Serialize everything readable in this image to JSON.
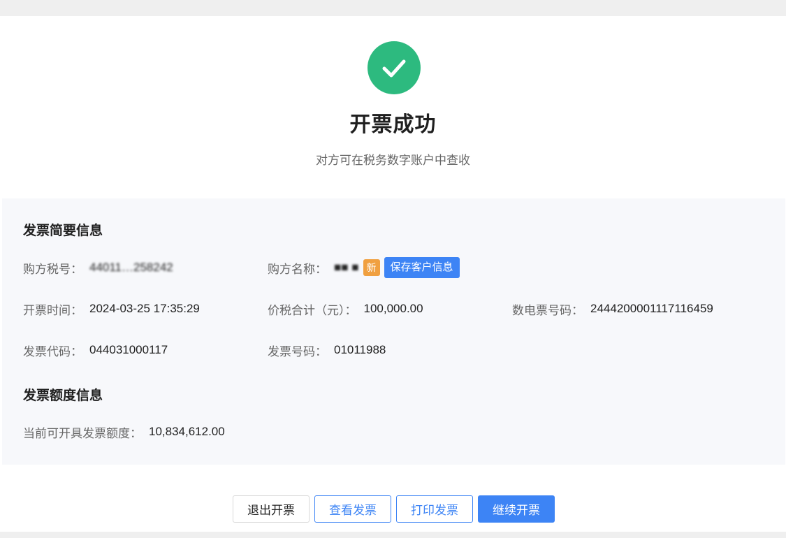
{
  "colors": {
    "success": "#2dba7f",
    "primary": "#3d84f5",
    "tag_new": "#f0a040"
  },
  "result": {
    "icon": "check-circle-icon",
    "title": "开票成功",
    "subtitle": "对方可在税务数字账户中查收"
  },
  "summary": {
    "title": "发票简要信息",
    "buyer_tax_no": {
      "label": "购方税号：",
      "value": "44011…258242"
    },
    "buyer_name": {
      "label": "购方名称：",
      "value": "■■ ■",
      "tag_new": "新",
      "save_button": "保存客户信息"
    },
    "issue_time": {
      "label": "开票时间：",
      "value": "2024-03-25 17:35:29"
    },
    "total_amount": {
      "label": "价税合计（元）：",
      "value": "100,000.00"
    },
    "e_invoice_no": {
      "label": "数电票号码：",
      "value": "2444200001117116459"
    },
    "invoice_code": {
      "label": "发票代码：",
      "value": "044031000117"
    },
    "invoice_no": {
      "label": "发票号码：",
      "value": "01011988"
    }
  },
  "quota": {
    "title": "发票额度信息",
    "available": {
      "label": "当前可开具发票额度：",
      "value": "10,834,612.00"
    }
  },
  "actions": {
    "exit": "退出开票",
    "view": "查看发票",
    "print": "打印发票",
    "continue": "继续开票"
  }
}
